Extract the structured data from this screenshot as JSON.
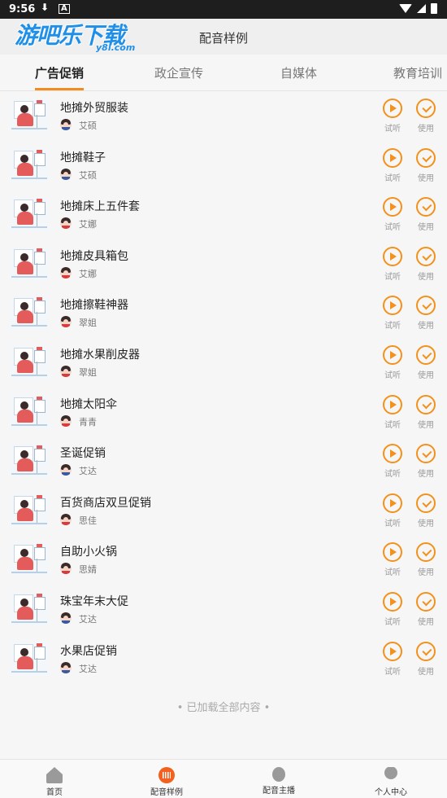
{
  "status_bar": {
    "time": "9:56",
    "download_icon": "download-icon",
    "a_icon": "A"
  },
  "header": {
    "logo_text": "游吧乐下载",
    "logo_sub": "y8l.com",
    "title": "配音样例"
  },
  "tabs": [
    {
      "label": "广告促销",
      "active": true
    },
    {
      "label": "政企宣传",
      "active": false
    },
    {
      "label": "自媒体",
      "active": false
    },
    {
      "label": "教育培训",
      "active": false
    }
  ],
  "items": [
    {
      "title": "地摊外贸服装",
      "author": "艾硕",
      "avatar": "male"
    },
    {
      "title": "地摊鞋子",
      "author": "艾硕",
      "avatar": "male"
    },
    {
      "title": "地摊床上五件套",
      "author": "艾娜",
      "avatar": "female"
    },
    {
      "title": "地摊皮具箱包",
      "author": "艾娜",
      "avatar": "female"
    },
    {
      "title": "地摊擦鞋神器",
      "author": "翠姐",
      "avatar": "female"
    },
    {
      "title": "地摊水果削皮器",
      "author": "翠姐",
      "avatar": "female"
    },
    {
      "title": "地摊太阳伞",
      "author": "青青",
      "avatar": "female"
    },
    {
      "title": "圣诞促销",
      "author": "艾达",
      "avatar": "male"
    },
    {
      "title": "百货商店双旦促销",
      "author": "思佳",
      "avatar": "female"
    },
    {
      "title": "自助小火锅",
      "author": "思婧",
      "avatar": "female"
    },
    {
      "title": "珠宝年末大促",
      "author": "艾达",
      "avatar": "male"
    },
    {
      "title": "水果店促销",
      "author": "艾达",
      "avatar": "male"
    }
  ],
  "actions": {
    "listen_label": "试听",
    "use_label": "使用"
  },
  "footer_text": "• 已加载全部内容 •",
  "bottom_nav": [
    {
      "label": "首页",
      "icon": "home-icon"
    },
    {
      "label": "配音样例",
      "icon": "voice-sample-icon",
      "active": true
    },
    {
      "label": "配音主播",
      "icon": "microphone-icon"
    },
    {
      "label": "个人中心",
      "icon": "user-icon"
    }
  ],
  "colors": {
    "accent": "#f2911b",
    "tab_underline": "#f28c1f"
  }
}
